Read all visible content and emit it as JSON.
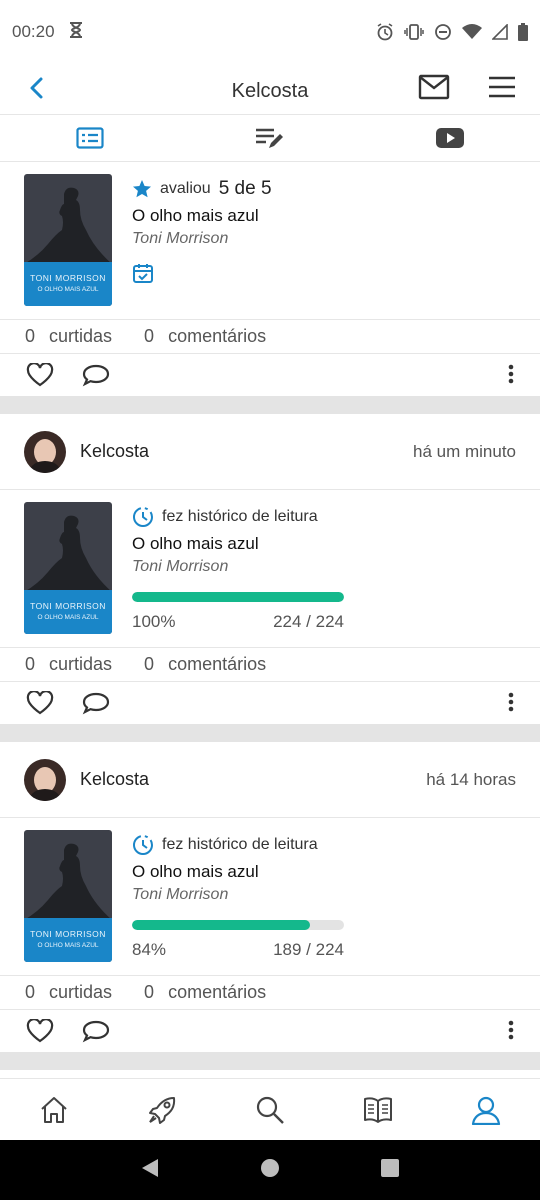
{
  "status_bar": {
    "time": "00:20"
  },
  "header": {
    "title": "Kelcosta"
  },
  "tabs": [
    {
      "name": "feed"
    },
    {
      "name": "reviews"
    },
    {
      "name": "videos"
    }
  ],
  "posts": [
    {
      "kind": "rating",
      "action": "avaliou",
      "rating": "5 de 5",
      "title": "O olho mais azul",
      "author": "Toni Morrison",
      "cover": {
        "author": "TONI MORRISON",
        "title": "O OLHO MAIS AZUL"
      },
      "likes_count": "0",
      "likes_label": "curtidas",
      "comments_count": "0",
      "comments_label": "comentários"
    },
    {
      "kind": "reading",
      "user": "Kelcosta",
      "time": "há um minuto",
      "action": "fez histórico de leitura",
      "title": "O olho mais azul",
      "author": "Toni Morrison",
      "cover": {
        "author": "TONI MORRISON",
        "title": "O OLHO MAIS AZUL"
      },
      "progress_percent": "100%",
      "progress_fraction": 1.0,
      "pages": "224 / 224",
      "likes_count": "0",
      "likes_label": "curtidas",
      "comments_count": "0",
      "comments_label": "comentários"
    },
    {
      "kind": "reading",
      "user": "Kelcosta",
      "time": "há 14 horas",
      "action": "fez histórico de leitura",
      "title": "O olho mais azul",
      "author": "Toni Morrison",
      "cover": {
        "author": "TONI MORRISON",
        "title": "O OLHO MAIS AZUL"
      },
      "progress_percent": "84%",
      "progress_fraction": 0.84,
      "pages": "189 / 224",
      "likes_count": "0",
      "likes_label": "curtidas",
      "comments_count": "0",
      "comments_label": "comentários"
    }
  ],
  "bottom_nav": [
    {
      "icon": "home-icon"
    },
    {
      "icon": "rocket-icon"
    },
    {
      "icon": "search-icon"
    },
    {
      "icon": "book-icon"
    },
    {
      "icon": "profile-icon",
      "active": true
    }
  ],
  "colors": {
    "accent": "#1a86c8",
    "progress": "#14b88c",
    "separator": "#e4e4e4"
  }
}
